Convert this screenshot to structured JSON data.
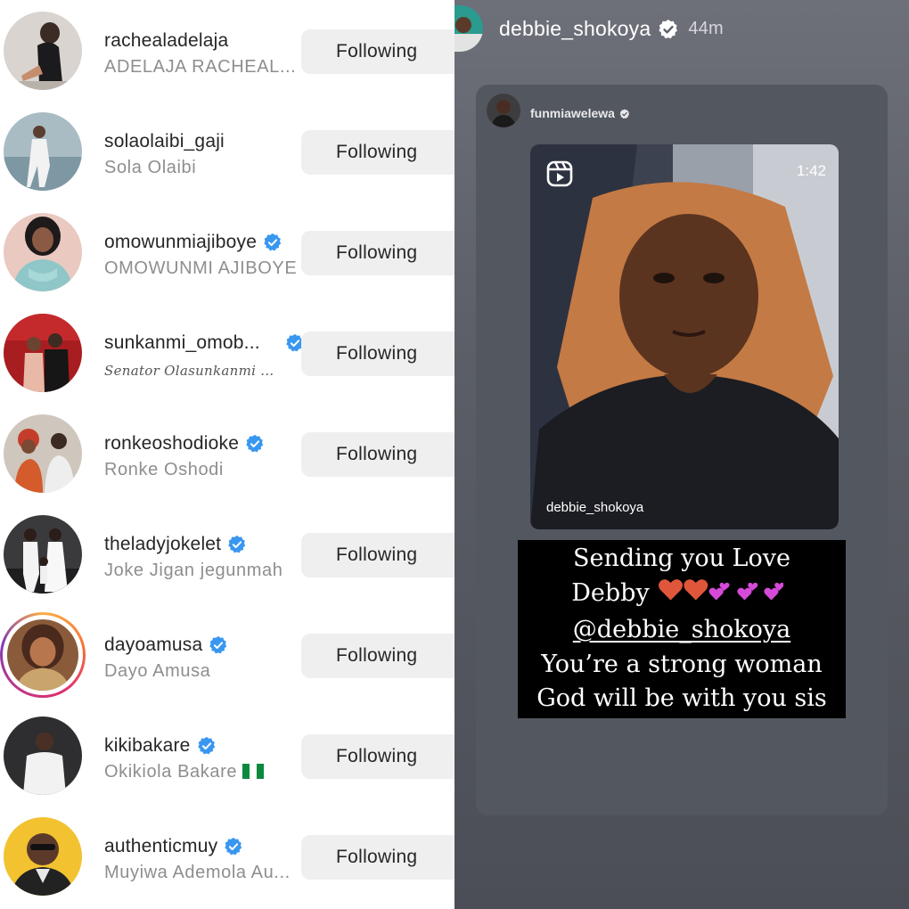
{
  "following": [
    {
      "username": "rachealadelaja",
      "full_name": "ADELAJA RACHEAL...",
      "verified": false,
      "button": "Following"
    },
    {
      "username": "solaolaibi_gaji",
      "full_name": "Sola Olaibi",
      "verified": false,
      "button": "Following"
    },
    {
      "username": "omowunmiajiboye",
      "full_name": "OMOWUNMI AJIBOYE",
      "verified": true,
      "button": "Following"
    },
    {
      "username": "sunkanmi_omob...",
      "full_name": "Senator Olasunkanmi ...",
      "verified": true,
      "button": "Following"
    },
    {
      "username": "ronkeoshodioke",
      "full_name": "Ronke Oshodi",
      "verified": true,
      "button": "Following"
    },
    {
      "username": "theladyjokelet",
      "full_name": "Joke Jigan jegunmah",
      "verified": true,
      "button": "Following"
    },
    {
      "username": "dayoamusa",
      "full_name": "Dayo Amusa",
      "verified": true,
      "button": "Following",
      "has_story": true
    },
    {
      "username": "kikibakare",
      "full_name": "Okikiola Bakare",
      "verified": true,
      "button": "Following",
      "flag": "nigeria-flag"
    },
    {
      "username": "authenticmuy",
      "full_name": "Muyiwa Ademola Au...",
      "verified": true,
      "button": "Following"
    }
  ],
  "story": {
    "username": "debbie_shokoya",
    "time": "44m",
    "shared_post": {
      "username": "funmiawelewa",
      "duration": "1:42",
      "video_handle": "debbie_shokoya",
      "icon": "reels-icon"
    },
    "caption": {
      "line1": "Sending you Love",
      "line2": "Debby",
      "line3": "@debbie_shokoya",
      "line4": "You’re a strong woman",
      "line5": "God will be with you sis"
    }
  },
  "colors": {
    "verified_blue": "#3897f0",
    "button_bg": "#efefef",
    "muted_text": "#8e8e8e",
    "story_bg": "#5b5e66"
  }
}
